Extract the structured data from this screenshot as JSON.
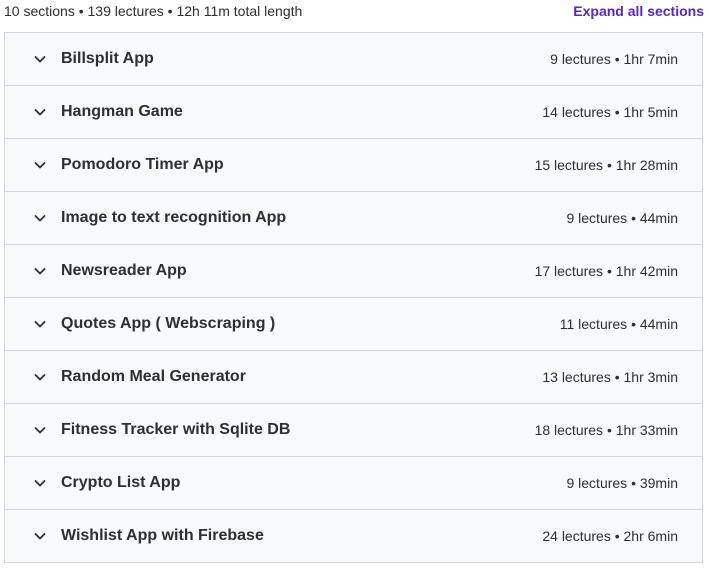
{
  "summary": {
    "text": "10 sections • 139 lectures • 12h 11m total length",
    "expand_label": "Expand all sections"
  },
  "sections": [
    {
      "title": "Billsplit App",
      "meta": "9 lectures • 1hr 7min"
    },
    {
      "title": "Hangman Game",
      "meta": "14 lectures • 1hr 5min"
    },
    {
      "title": "Pomodoro Timer App",
      "meta": "15 lectures • 1hr 28min"
    },
    {
      "title": "Image to text recognition App",
      "meta": "9 lectures • 44min"
    },
    {
      "title": "Newsreader App",
      "meta": "17 lectures • 1hr 42min"
    },
    {
      "title": "Quotes App ( Webscraping )",
      "meta": "11 lectures • 44min"
    },
    {
      "title": "Random Meal Generator",
      "meta": "13 lectures • 1hr 3min"
    },
    {
      "title": "Fitness Tracker with Sqlite DB",
      "meta": "18 lectures • 1hr 33min"
    },
    {
      "title": "Crypto List App",
      "meta": "9 lectures • 39min"
    },
    {
      "title": "Wishlist App with Firebase",
      "meta": "24 lectures • 2hr 6min"
    }
  ],
  "icons": {
    "chevron": "chevron-down-icon"
  },
  "colors": {
    "accent": "#5624d0",
    "row_background": "#f7f9fa",
    "border": "#d1d7dc",
    "text": "#2d2f31"
  }
}
